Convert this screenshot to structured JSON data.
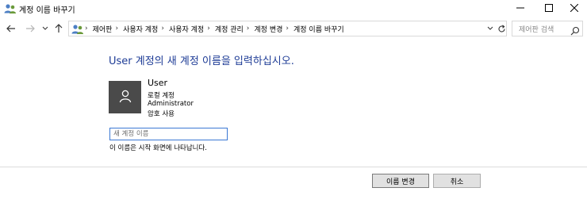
{
  "window": {
    "title": "계정 이름 바꾸기"
  },
  "nav": {
    "breadcrumbs": [
      "제어판",
      "사용자 계정",
      "사용자 계정",
      "계정 관리",
      "계정 변경",
      "계정 이름 바꾸기"
    ],
    "search_placeholder": "제어판 검색"
  },
  "main": {
    "heading": "User 계정의 새 계정 이름을 입력하십시오.",
    "account": {
      "name": "User",
      "type": "로컬 계정",
      "role": "Administrator",
      "password_status": "암호 사용"
    },
    "new_name_input": {
      "value": "",
      "placeholder": "새 계정 이름"
    },
    "hint": "이 이름은 시작 화면에 나타납니다."
  },
  "buttons": {
    "rename": "이름 변경",
    "cancel": "취소"
  },
  "colors": {
    "heading": "#1e3c96",
    "input_border": "#3b78d4",
    "avatar_bg": "#4a4a4a"
  }
}
